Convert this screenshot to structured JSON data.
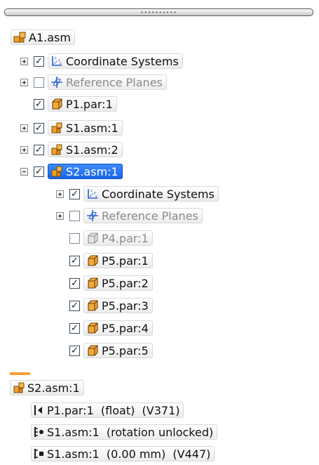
{
  "splitter": {
    "grip": "••••••••••"
  },
  "tree": {
    "root": {
      "label": "A1.asm",
      "icon": "assembly-icon"
    },
    "a1_items": [
      {
        "label": "Coordinate Systems",
        "icon": "coordinate-system-icon",
        "checked": true,
        "expand": "plus",
        "dim": false
      },
      {
        "label": "Reference Planes",
        "icon": "reference-plane-icon",
        "checked": false,
        "expand": "plus",
        "dim": true
      },
      {
        "label": "P1.par:1",
        "icon": "part-icon",
        "checked": true,
        "expand": "none",
        "dim": false
      },
      {
        "label": "S1.asm:1",
        "icon": "subassembly-icon",
        "checked": true,
        "expand": "plus",
        "dim": false
      },
      {
        "label": "S1.asm:2",
        "icon": "subassembly-icon",
        "checked": true,
        "expand": "plus",
        "dim": false
      },
      {
        "label": "S2.asm:1",
        "icon": "subassembly-icon",
        "checked": true,
        "expand": "minus",
        "dim": false,
        "selected": true
      }
    ],
    "s2_items": [
      {
        "label": "Coordinate Systems",
        "icon": "coordinate-system-icon",
        "checked": true,
        "expand": "plus",
        "dim": false
      },
      {
        "label": "Reference Planes",
        "icon": "reference-plane-icon",
        "checked": false,
        "expand": "plus",
        "dim": true
      },
      {
        "label": "P4.par:1",
        "icon": "part-hidden-icon",
        "checked": false,
        "expand": "none",
        "dim": true
      },
      {
        "label": "P5.par:1",
        "icon": "part-icon",
        "checked": true,
        "expand": "none",
        "dim": false
      },
      {
        "label": "P5.par:2",
        "icon": "part-icon",
        "checked": true,
        "expand": "none",
        "dim": false
      },
      {
        "label": "P5.par:3",
        "icon": "part-icon",
        "checked": true,
        "expand": "none",
        "dim": false
      },
      {
        "label": "P5.par:4",
        "icon": "part-icon",
        "checked": true,
        "expand": "none",
        "dim": false
      },
      {
        "label": "P5.par:5",
        "icon": "part-icon",
        "checked": true,
        "expand": "none",
        "dim": false
      }
    ]
  },
  "relationships": {
    "header": {
      "label": "S2.asm:1",
      "icon": "subassembly-icon"
    },
    "items": [
      {
        "label": "P1.par:1  (float)  (V371)",
        "icon": "axial-align-relationship-icon"
      },
      {
        "label": "S1.asm:1  (rotation unlocked)",
        "icon": "cylindrical-relationship-icon"
      },
      {
        "label": "S1.asm:1  (0.00 mm)  (V447)",
        "icon": "mate-relationship-icon"
      }
    ]
  },
  "colors": {
    "selection": "#1a66e6",
    "accent_orange": "#f7a032",
    "part_orange": "#e8961e",
    "icon_blue": "#2b62d6"
  }
}
